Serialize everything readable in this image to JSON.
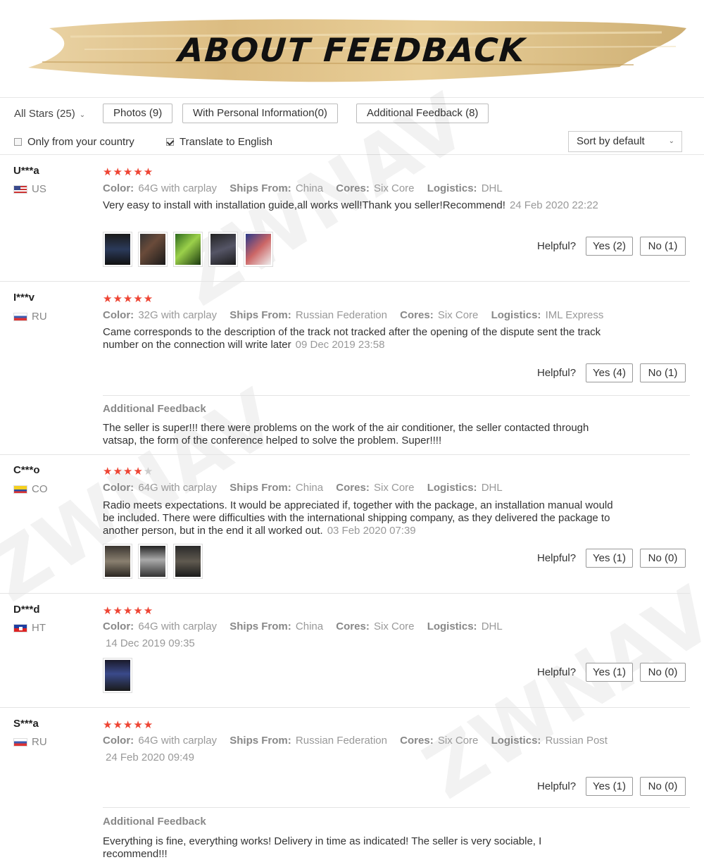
{
  "header": {
    "title": "ABOUT FEEDBACK"
  },
  "filters": {
    "all_stars": "All Stars (25)",
    "photos": "Photos (9)",
    "personal_info": "With Personal Information(0)",
    "additional": "Additional Feedback (8)",
    "only_country": "Only from your country",
    "translate": "Translate to English",
    "translate_checked": true,
    "only_country_checked": false,
    "sort": "Sort by default"
  },
  "labels": {
    "color": "Color:",
    "ships_from": "Ships From:",
    "cores": "Cores:",
    "logistics": "Logistics:",
    "helpful": "Helpful?",
    "additional_feedback": "Additional Feedback"
  },
  "watermark": "ZWNAV",
  "reviews": [
    {
      "user": "U***a",
      "country": "US",
      "stars": 5,
      "color": "64G with carplay",
      "ships_from": "China",
      "cores": "Six Core",
      "logistics": "DHL",
      "text": "Very easy to install with installation guide,all works well!Thank you seller!Recommend!",
      "date": "24 Feb 2020 22:22",
      "yes": "Yes (2)",
      "no": "No (1)",
      "photo_count": 5
    },
    {
      "user": "I***v",
      "country": "RU",
      "stars": 5,
      "color": "32G with carplay",
      "ships_from": "Russian Federation",
      "cores": "Six Core",
      "logistics": "IML Express",
      "text": "Came corresponds to the description of the track not tracked after the opening of the dispute sent the track number on the connection will write later",
      "date": "09 Dec 2019 23:58",
      "yes": "Yes (4)",
      "no": "No (1)",
      "additional": "The seller is super!!! there were problems on the work of the air conditioner, the seller contacted through vatsap, the form of the conference helped to solve the problem. Super!!!!"
    },
    {
      "user": "C***o",
      "country": "CO",
      "stars": 4,
      "color": "64G with carplay",
      "ships_from": "China",
      "cores": "Six Core",
      "logistics": "DHL",
      "text": "Radio meets expectations. It would be appreciated if, together with the package, an installation manual would be included. There were difficulties with the international shipping company, as they delivered the package to another person, but in the end it all worked out.",
      "date": "03 Feb 2020 07:39",
      "yes": "Yes (1)",
      "no": "No (0)",
      "photo_count": 3
    },
    {
      "user": "D***d",
      "country": "HT",
      "stars": 5,
      "color": "64G with carplay",
      "ships_from": "China",
      "cores": "Six Core",
      "logistics": "DHL",
      "date": "14 Dec 2019 09:35",
      "yes": "Yes (1)",
      "no": "No (0)",
      "photo_count": 1
    },
    {
      "user": "S***a",
      "country": "RU",
      "stars": 5,
      "color": "64G with carplay",
      "ships_from": "Russian Federation",
      "cores": "Six Core",
      "logistics": "Russian Post",
      "date": "24 Feb 2020 09:49",
      "yes": "Yes (1)",
      "no": "No (0)",
      "additional": "Everything is fine, everything works! Delivery in time as indicated! The seller is very sociable, I recommend!!!"
    }
  ]
}
